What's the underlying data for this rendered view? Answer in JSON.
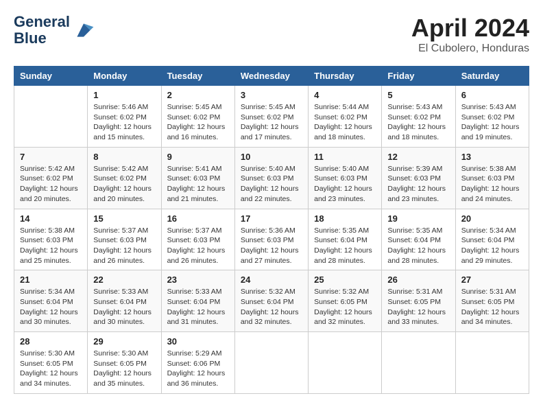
{
  "header": {
    "logo_line1": "General",
    "logo_line2": "Blue",
    "month": "April 2024",
    "location": "El Cubolero, Honduras"
  },
  "days_of_week": [
    "Sunday",
    "Monday",
    "Tuesday",
    "Wednesday",
    "Thursday",
    "Friday",
    "Saturday"
  ],
  "weeks": [
    [
      {
        "day": "",
        "info": ""
      },
      {
        "day": "1",
        "info": "Sunrise: 5:46 AM\nSunset: 6:02 PM\nDaylight: 12 hours\nand 15 minutes."
      },
      {
        "day": "2",
        "info": "Sunrise: 5:45 AM\nSunset: 6:02 PM\nDaylight: 12 hours\nand 16 minutes."
      },
      {
        "day": "3",
        "info": "Sunrise: 5:45 AM\nSunset: 6:02 PM\nDaylight: 12 hours\nand 17 minutes."
      },
      {
        "day": "4",
        "info": "Sunrise: 5:44 AM\nSunset: 6:02 PM\nDaylight: 12 hours\nand 18 minutes."
      },
      {
        "day": "5",
        "info": "Sunrise: 5:43 AM\nSunset: 6:02 PM\nDaylight: 12 hours\nand 18 minutes."
      },
      {
        "day": "6",
        "info": "Sunrise: 5:43 AM\nSunset: 6:02 PM\nDaylight: 12 hours\nand 19 minutes."
      }
    ],
    [
      {
        "day": "7",
        "info": "Sunrise: 5:42 AM\nSunset: 6:02 PM\nDaylight: 12 hours\nand 20 minutes."
      },
      {
        "day": "8",
        "info": "Sunrise: 5:42 AM\nSunset: 6:02 PM\nDaylight: 12 hours\nand 20 minutes."
      },
      {
        "day": "9",
        "info": "Sunrise: 5:41 AM\nSunset: 6:03 PM\nDaylight: 12 hours\nand 21 minutes."
      },
      {
        "day": "10",
        "info": "Sunrise: 5:40 AM\nSunset: 6:03 PM\nDaylight: 12 hours\nand 22 minutes."
      },
      {
        "day": "11",
        "info": "Sunrise: 5:40 AM\nSunset: 6:03 PM\nDaylight: 12 hours\nand 23 minutes."
      },
      {
        "day": "12",
        "info": "Sunrise: 5:39 AM\nSunset: 6:03 PM\nDaylight: 12 hours\nand 23 minutes."
      },
      {
        "day": "13",
        "info": "Sunrise: 5:38 AM\nSunset: 6:03 PM\nDaylight: 12 hours\nand 24 minutes."
      }
    ],
    [
      {
        "day": "14",
        "info": "Sunrise: 5:38 AM\nSunset: 6:03 PM\nDaylight: 12 hours\nand 25 minutes."
      },
      {
        "day": "15",
        "info": "Sunrise: 5:37 AM\nSunset: 6:03 PM\nDaylight: 12 hours\nand 26 minutes."
      },
      {
        "day": "16",
        "info": "Sunrise: 5:37 AM\nSunset: 6:03 PM\nDaylight: 12 hours\nand 26 minutes."
      },
      {
        "day": "17",
        "info": "Sunrise: 5:36 AM\nSunset: 6:03 PM\nDaylight: 12 hours\nand 27 minutes."
      },
      {
        "day": "18",
        "info": "Sunrise: 5:35 AM\nSunset: 6:04 PM\nDaylight: 12 hours\nand 28 minutes."
      },
      {
        "day": "19",
        "info": "Sunrise: 5:35 AM\nSunset: 6:04 PM\nDaylight: 12 hours\nand 28 minutes."
      },
      {
        "day": "20",
        "info": "Sunrise: 5:34 AM\nSunset: 6:04 PM\nDaylight: 12 hours\nand 29 minutes."
      }
    ],
    [
      {
        "day": "21",
        "info": "Sunrise: 5:34 AM\nSunset: 6:04 PM\nDaylight: 12 hours\nand 30 minutes."
      },
      {
        "day": "22",
        "info": "Sunrise: 5:33 AM\nSunset: 6:04 PM\nDaylight: 12 hours\nand 30 minutes."
      },
      {
        "day": "23",
        "info": "Sunrise: 5:33 AM\nSunset: 6:04 PM\nDaylight: 12 hours\nand 31 minutes."
      },
      {
        "day": "24",
        "info": "Sunrise: 5:32 AM\nSunset: 6:04 PM\nDaylight: 12 hours\nand 32 minutes."
      },
      {
        "day": "25",
        "info": "Sunrise: 5:32 AM\nSunset: 6:05 PM\nDaylight: 12 hours\nand 32 minutes."
      },
      {
        "day": "26",
        "info": "Sunrise: 5:31 AM\nSunset: 6:05 PM\nDaylight: 12 hours\nand 33 minutes."
      },
      {
        "day": "27",
        "info": "Sunrise: 5:31 AM\nSunset: 6:05 PM\nDaylight: 12 hours\nand 34 minutes."
      }
    ],
    [
      {
        "day": "28",
        "info": "Sunrise: 5:30 AM\nSunset: 6:05 PM\nDaylight: 12 hours\nand 34 minutes."
      },
      {
        "day": "29",
        "info": "Sunrise: 5:30 AM\nSunset: 6:05 PM\nDaylight: 12 hours\nand 35 minutes."
      },
      {
        "day": "30",
        "info": "Sunrise: 5:29 AM\nSunset: 6:06 PM\nDaylight: 12 hours\nand 36 minutes."
      },
      {
        "day": "",
        "info": ""
      },
      {
        "day": "",
        "info": ""
      },
      {
        "day": "",
        "info": ""
      },
      {
        "day": "",
        "info": ""
      }
    ]
  ]
}
